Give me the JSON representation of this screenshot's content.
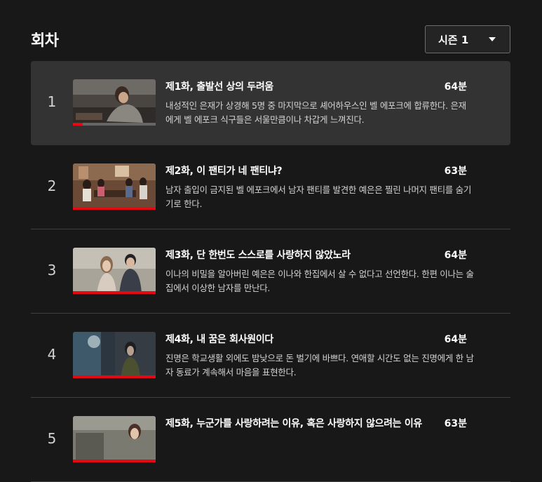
{
  "section": {
    "title": "회차"
  },
  "season_selector": {
    "selected": "시즌 1"
  },
  "episodes": [
    {
      "number": "1",
      "title": "제1화, 출발선 상의 두려움",
      "duration": "64분",
      "synopsis": "내성적인 은재가 상경해 5명 중 마지막으로 셰어하우스인 벨 에포크에 합류한다. 은재에게 벨 에포크 식구들은 서울만큼이나 차갑게 느껴진다.",
      "watched_fraction": 0.12
    },
    {
      "number": "2",
      "title": "제2화, 이 팬티가 네 팬티냐?",
      "duration": "63분",
      "synopsis": "남자 출입이 금지된 벨 에포크에서 남자 팬티를 발견한 예은은 찔린 나머지 팬티를 숨기기로 한다.",
      "watched_fraction": 1.0
    },
    {
      "number": "3",
      "title": "제3화, 단 한번도 스스로를 사랑하지 않았노라",
      "duration": "64분",
      "synopsis": "이나의 비밀을 알아버린 예은은 이나와 한집에서 살 수 없다고 선언한다. 한편 이나는 술집에서 이상한 남자를 만난다.",
      "watched_fraction": 1.0
    },
    {
      "number": "4",
      "title": "제4화, 내 꿈은 회사원이다",
      "duration": "64분",
      "synopsis": "진명은 학교생활 외에도 밤낮으로 돈 벌기에 바쁘다. 연애할 시간도 없는 진명에게 한 남자 동료가 계속해서 마음을 표현한다.",
      "watched_fraction": 1.0
    },
    {
      "number": "5",
      "title": "제5화, 누군가를 사랑하려는 이유, 혹은 사랑하지 않으려는 이유",
      "duration": "63분",
      "synopsis": "",
      "watched_fraction": 1.0
    }
  ],
  "colors": {
    "background": "#181818",
    "active_row": "#333333",
    "progress": "#e50914"
  },
  "icons": {
    "season_dropdown": "caret-down-icon"
  }
}
